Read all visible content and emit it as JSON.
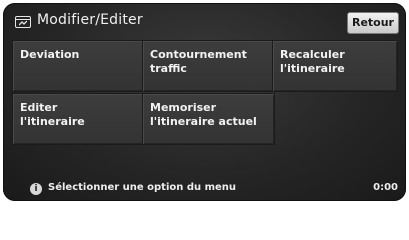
{
  "header": {
    "title": "Modifier/Editer",
    "title_icon": "edit-route-icon",
    "back_label": "Retour"
  },
  "menu": {
    "items": [
      {
        "label": "Deviation"
      },
      {
        "label": "Contournement\ntraffic"
      },
      {
        "label": "Recalculer\nl'itineraire"
      },
      {
        "label": "Editer\nl'itineraire"
      },
      {
        "label": "Memoriser\nl'itineraire actuel"
      }
    ]
  },
  "status": {
    "info_icon": "info-icon",
    "info_glyph": "i",
    "message": "Sélectionner une option du menu",
    "time": "0:00"
  },
  "colors": {
    "background": "#2a2a2a",
    "button": "#383838",
    "text": "#f2f2f2",
    "back_button": "#e0e0e0"
  }
}
